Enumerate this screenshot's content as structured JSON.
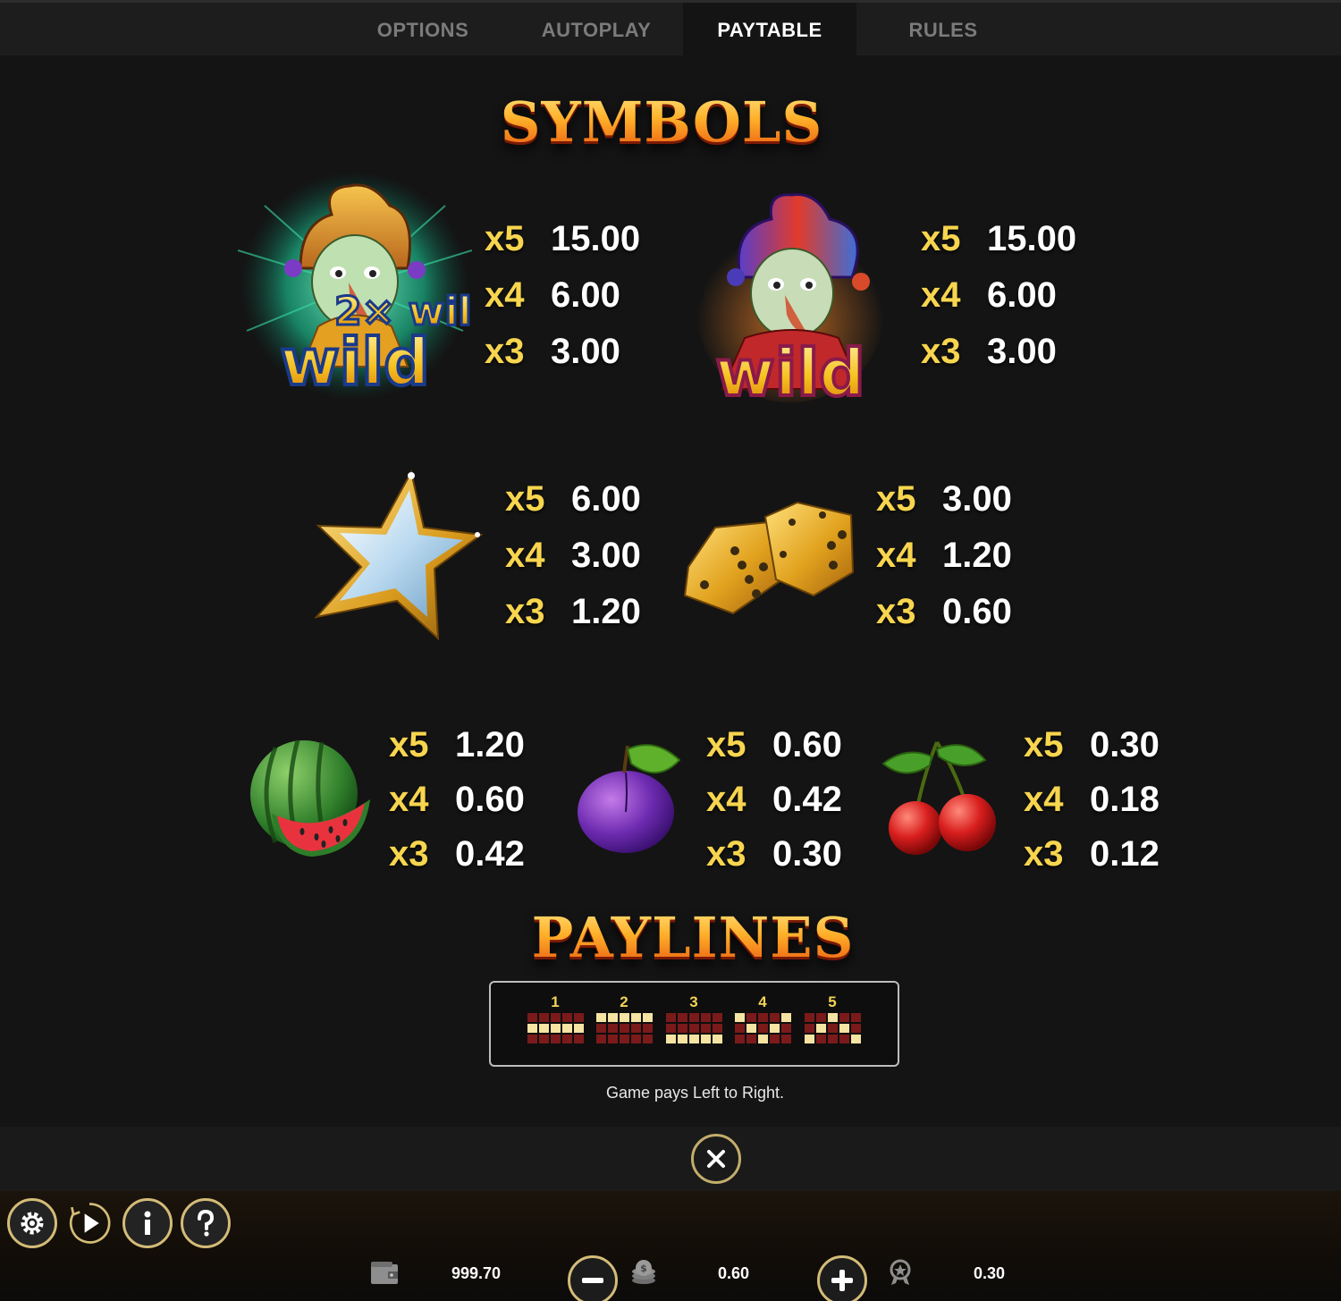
{
  "tabs": [
    {
      "label": "OPTIONS",
      "active": false
    },
    {
      "label": "AUTOPLAY",
      "active": false
    },
    {
      "label": "PAYTABLE",
      "active": true
    },
    {
      "label": "RULES",
      "active": false
    }
  ],
  "symbols_title": "SYMBOLS",
  "paylines_title": "PAYLINES",
  "wild_labels": {
    "double_wild": "2× wild",
    "wild": "wild"
  },
  "symbols": [
    {
      "name": "2x wild jester",
      "icon": "double-wild-jester-icon",
      "pays": [
        {
          "mult": "x5",
          "value": "15.00"
        },
        {
          "mult": "x4",
          "value": "6.00"
        },
        {
          "mult": "x3",
          "value": "3.00"
        }
      ]
    },
    {
      "name": "wild jester",
      "icon": "wild-jester-icon",
      "pays": [
        {
          "mult": "x5",
          "value": "15.00"
        },
        {
          "mult": "x4",
          "value": "6.00"
        },
        {
          "mult": "x3",
          "value": "3.00"
        }
      ]
    },
    {
      "name": "star",
      "icon": "star-icon",
      "pays": [
        {
          "mult": "x5",
          "value": "6.00"
        },
        {
          "mult": "x4",
          "value": "3.00"
        },
        {
          "mult": "x3",
          "value": "1.20"
        }
      ]
    },
    {
      "name": "dice",
      "icon": "dice-icon",
      "pays": [
        {
          "mult": "x5",
          "value": "3.00"
        },
        {
          "mult": "x4",
          "value": "1.20"
        },
        {
          "mult": "x3",
          "value": "0.60"
        }
      ]
    },
    {
      "name": "watermelon",
      "icon": "watermelon-icon",
      "pays": [
        {
          "mult": "x5",
          "value": "1.20"
        },
        {
          "mult": "x4",
          "value": "0.60"
        },
        {
          "mult": "x3",
          "value": "0.42"
        }
      ]
    },
    {
      "name": "plum",
      "icon": "plum-icon",
      "pays": [
        {
          "mult": "x5",
          "value": "0.60"
        },
        {
          "mult": "x4",
          "value": "0.42"
        },
        {
          "mult": "x3",
          "value": "0.30"
        }
      ]
    },
    {
      "name": "cherry",
      "icon": "cherry-icon",
      "pays": [
        {
          "mult": "x5",
          "value": "0.30"
        },
        {
          "mult": "x4",
          "value": "0.18"
        },
        {
          "mult": "x3",
          "value": "0.12"
        }
      ]
    }
  ],
  "paylines": [
    {
      "number": "1",
      "rows": [
        1,
        1,
        1,
        1,
        1
      ]
    },
    {
      "number": "2",
      "rows": [
        0,
        0,
        0,
        0,
        0
      ]
    },
    {
      "number": "3",
      "rows": [
        2,
        2,
        2,
        2,
        2
      ]
    },
    {
      "number": "4",
      "rows": [
        0,
        1,
        2,
        1,
        0
      ]
    },
    {
      "number": "5",
      "rows": [
        2,
        1,
        0,
        1,
        2
      ]
    }
  ],
  "note": "Game pays Left to Right.",
  "bottom": {
    "balance": "999.70",
    "bet": "0.60",
    "win": "0.30"
  },
  "colors": {
    "multiplier": "#f7d54e",
    "accent_border": "#d4bc78",
    "payline_on": "#f6e4a2",
    "payline_off": "#7b1a1a"
  }
}
